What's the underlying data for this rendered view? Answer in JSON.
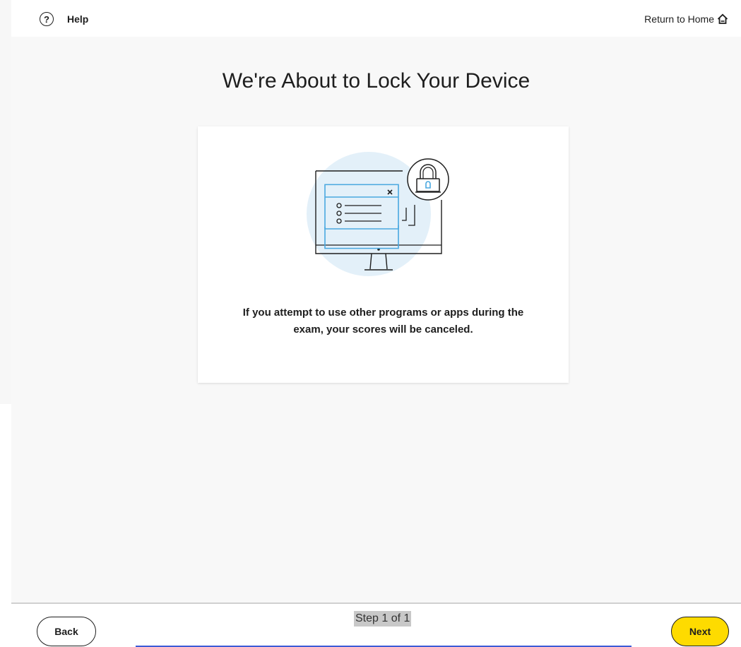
{
  "header": {
    "help_label": "Help",
    "help_icon": "?",
    "home_label": "Return to Home"
  },
  "main": {
    "title": "We're About to Lock Your Device",
    "message": "If you attempt to use other programs or apps during the exam, your scores will be canceled."
  },
  "footer": {
    "back_label": "Back",
    "step_text": "Step 1 of 1",
    "next_label": "Next"
  },
  "colors": {
    "background": "#f8f8f8",
    "accent_yellow": "#fedb00",
    "illustration_blue": "#4aa8e0",
    "illustration_circle": "#e3f0f9",
    "progress_blue": "#3c5bd6"
  },
  "icons": [
    "help-circle-icon",
    "home-icon",
    "lock-icon",
    "close-icon"
  ]
}
